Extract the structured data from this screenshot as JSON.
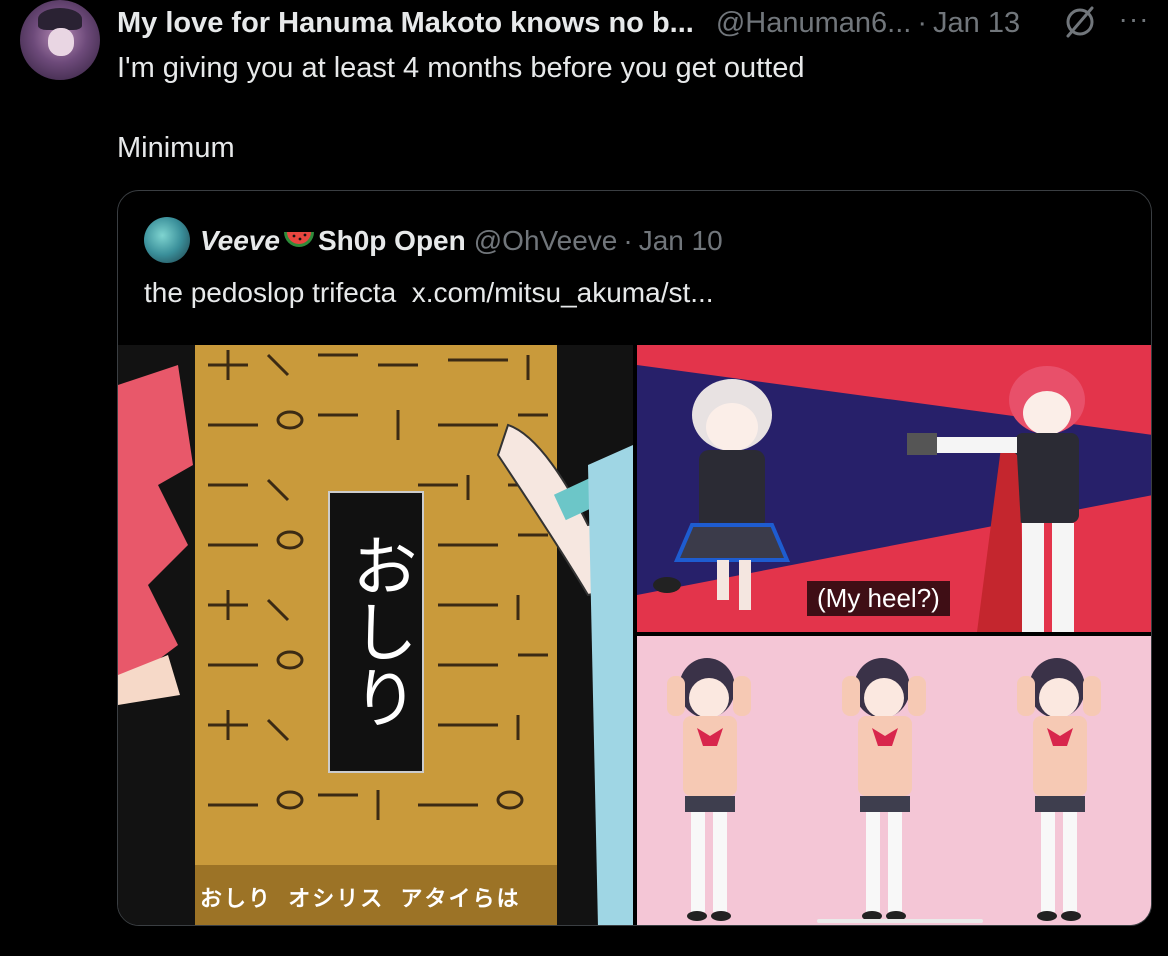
{
  "tweet": {
    "display_name": "My love for Hanuma Makoto knows no b...",
    "handle": "@Hanuman6...",
    "separator": "·",
    "date": "Jan 13",
    "text": "I'm giving you at least 4 months before you get outted\n\nMinimum",
    "icons": [
      "grok-icon",
      "more-icon"
    ]
  },
  "quoted_tweet": {
    "name_part1": "Veeve",
    "name_part2": "Sh0p Open",
    "handle": "@OhVeeve",
    "separator": "·",
    "date": "Jan 10",
    "text": "the pedoslop trifecta  x.com/mitsu_akuma/st...",
    "media": {
      "left_image": {
        "overlay_text": "おしり",
        "caption": "おしり  オシリス  アタイらは"
      },
      "top_right_image": {
        "subtitle": "(My heel?)"
      },
      "bottom_right_image": {}
    }
  },
  "colors": {
    "background": "#000000",
    "text_primary": "#e7e9ea",
    "text_secondary": "#71767b",
    "border": "#3a3e42"
  }
}
